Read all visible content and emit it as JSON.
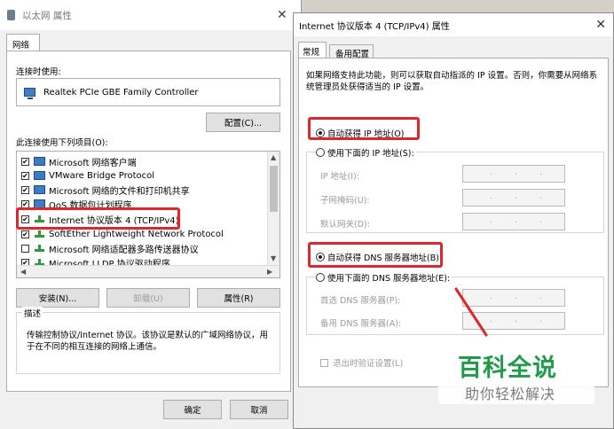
{
  "left_dialog": {
    "title": "以太网 属性",
    "tab": "网络",
    "connect_using_label": "连接时使用:",
    "adapter": "Realtek PCIe GBE Family Controller",
    "configure_button": "配置(C)...",
    "items_label": "此连接使用下列项目(O):",
    "items": [
      {
        "label": "Microsoft 网络客户端",
        "checked": true,
        "icon": "network-client-icon"
      },
      {
        "label": "VMware Bridge Protocol",
        "checked": true,
        "icon": "network-client-icon"
      },
      {
        "label": "Microsoft 网络的文件和打印机共享",
        "checked": true,
        "icon": "network-client-icon"
      },
      {
        "label": "QoS 数据包计划程序",
        "checked": true,
        "icon": "network-client-icon"
      },
      {
        "label": "Internet 协议版本 4 (TCP/IPv4)",
        "checked": true,
        "icon": "protocol-icon"
      },
      {
        "label": "SoftEther Lightweight Network Protocol",
        "checked": true,
        "icon": "protocol-icon"
      },
      {
        "label": "Microsoft 网络适配器多路传送器协议",
        "checked": false,
        "icon": "protocol-icon"
      },
      {
        "label": "Microsoft LLDP 协议驱动程序",
        "checked": true,
        "icon": "protocol-icon"
      }
    ],
    "install_button": "安装(N)...",
    "uninstall_button": "卸载(U)",
    "properties_button": "属性(R)",
    "description_title": "描述",
    "description_text": "传输控制协议/Internet 协议。该协议是默认的广域网络协议，用于在不同的相互连接的网络上通信。",
    "ok_button": "确定",
    "cancel_button": "取消"
  },
  "right_dialog": {
    "title": "Internet 协议版本 4 (TCP/IPv4) 属性",
    "tabs": [
      "常规",
      "备用配置"
    ],
    "intro_text": "如果网络支持此功能，则可以获取自动指派的 IP 设置。否则，你需要从网络系统管理员处获得适当的 IP 设置。",
    "auto_ip_option": "自动获得 IP 地址(O)",
    "manual_ip_option": "使用下面的 IP 地址(S):",
    "ip_address_label": "IP 地址(I):",
    "subnet_label": "子网掩码(U):",
    "gateway_label": "默认网关(D):",
    "auto_dns_option": "自动获得 DNS 服务器地址(B)",
    "manual_dns_option": "使用下面的 DNS 服务器地址(E):",
    "preferred_dns_label": "首选 DNS 服务器(P):",
    "alternate_dns_label": "备用 DNS 服务器(A):",
    "validate_on_exit": "退出时验证设置(L)",
    "ip_dot": ".",
    "selected_ip_option": "auto",
    "selected_dns_option": "auto"
  },
  "watermark": {
    "line1": "百科全说",
    "line2": "助你轻松解决"
  },
  "colors": {
    "highlight": "#e0262b",
    "watermark_green": "#1f9c4a"
  }
}
